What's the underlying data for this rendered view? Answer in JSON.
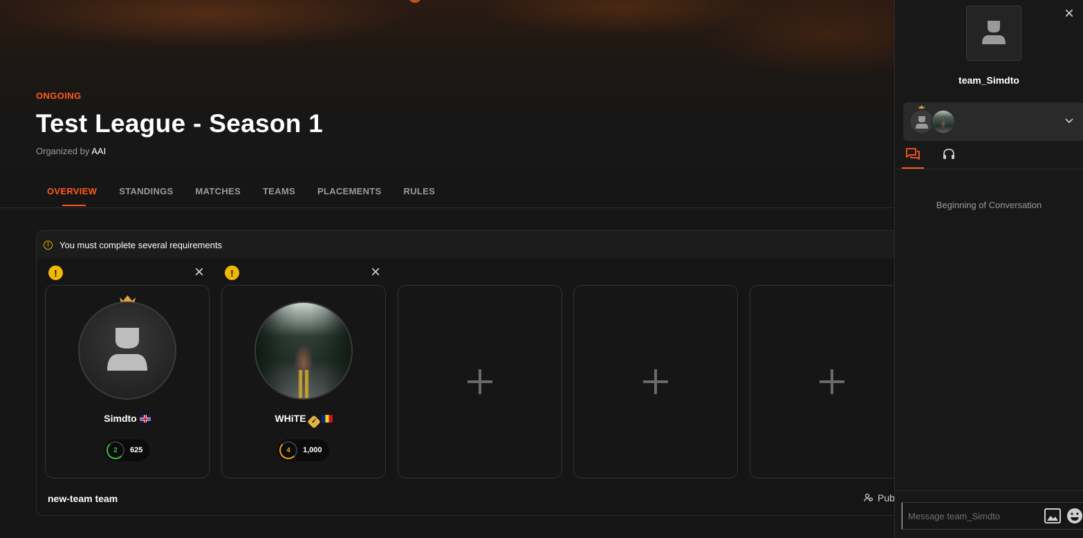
{
  "league": {
    "status": "ONGOING",
    "title": "Test League - Season 1",
    "organized_by_label": "Organized by",
    "organizer": "AAI"
  },
  "tabs": [
    {
      "label": "OVERVIEW",
      "active": true
    },
    {
      "label": "STANDINGS"
    },
    {
      "label": "MATCHES"
    },
    {
      "label": "TEAMS"
    },
    {
      "label": "PLACEMENTS"
    },
    {
      "label": "RULES"
    }
  ],
  "team_panel": {
    "requirements_text": "You must complete several requirements",
    "team_name": "new-team team",
    "visibility_label": "Pub",
    "players": [
      {
        "name": "Simdto",
        "flag": "uk",
        "level": "2",
        "elo": "625",
        "captain": true,
        "level_color": "#39c24a"
      },
      {
        "name": "WHiTE",
        "flag": "ro",
        "level": "4",
        "elo": "1,000",
        "verified": true,
        "level_color": "#f2a20c"
      }
    ],
    "empty_slots": 3
  },
  "chat": {
    "team_name": "team_Simdto",
    "conversation_start": "Beginning of Conversation",
    "message_placeholder": "Message team_Simdto"
  },
  "colors": {
    "accent": "#ff5a1f",
    "warning": "#f2b705"
  }
}
